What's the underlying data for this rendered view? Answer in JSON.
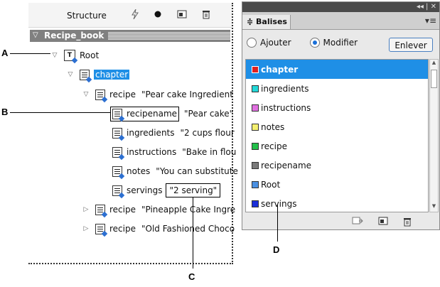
{
  "structure_panel": {
    "title": "Structure",
    "root_bar": "Recipe_book",
    "rows": [
      {
        "name": "Root",
        "value": ""
      },
      {
        "name": "chapter",
        "value": ""
      },
      {
        "name": "recipe",
        "value": "\"Pear cake Ingredient"
      },
      {
        "name": "recipename",
        "value": "\"Pear cake\""
      },
      {
        "name": "ingredients",
        "value": "\"2 cups flour"
      },
      {
        "name": "instructions",
        "value": "\"Bake in flou"
      },
      {
        "name": "notes",
        "value": "\"You can substitute"
      },
      {
        "name": "servings",
        "value": "\"2 serving\""
      },
      {
        "name": "recipe",
        "value": "\"Pineapple Cake Ingre"
      },
      {
        "name": "recipe",
        "value": "\"Old Fashioned Choco"
      }
    ]
  },
  "balises_panel": {
    "tab": "Balises",
    "radio_add": "Ajouter",
    "radio_modify": "Modifier",
    "remove_button": "Enlever",
    "tags": [
      {
        "name": "chapter",
        "color": "#e02020"
      },
      {
        "name": "ingredients",
        "color": "#22d8d8"
      },
      {
        "name": "instructions",
        "color": "#e070e0"
      },
      {
        "name": "notes",
        "color": "#f4f070"
      },
      {
        "name": "recipe",
        "color": "#22c04a"
      },
      {
        "name": "recipename",
        "color": "#7a7a7a"
      },
      {
        "name": "Root",
        "color": "#4a90e2"
      },
      {
        "name": "servings",
        "color": "#1a2ed8"
      }
    ]
  },
  "callouts": {
    "a": "A",
    "b": "B",
    "c": "C",
    "d": "D"
  },
  "colors": {
    "selection": "#1f8fe6",
    "panel_bg": "#e9e9e9"
  }
}
